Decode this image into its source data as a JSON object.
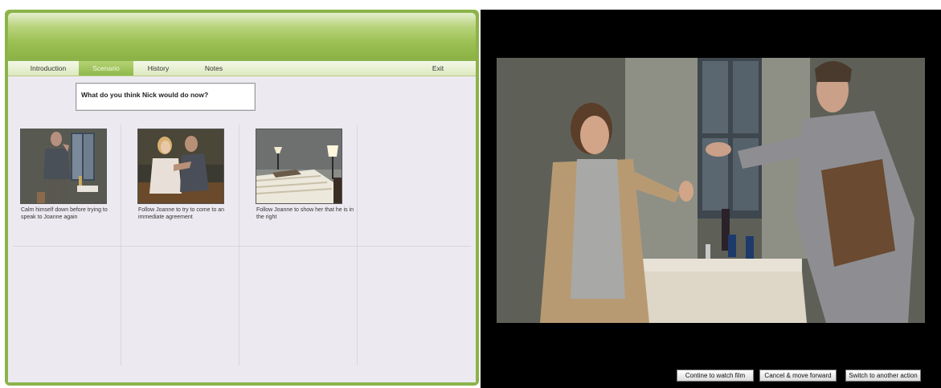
{
  "tabs": [
    {
      "label": "Introduction",
      "active": false
    },
    {
      "label": "Scenario",
      "active": true
    },
    {
      "label": "History",
      "active": false
    },
    {
      "label": "Notes",
      "active": false
    }
  ],
  "exit_label": "Exit",
  "question": "What do you think Nick would do now?",
  "options": [
    {
      "caption": "Calm himself down before trying to speak to Joanne again",
      "thumbnail": "man-at-window-thumbnail"
    },
    {
      "caption": "Follow Joanne to try to come to an immediate agreement",
      "thumbnail": "couple-on-bed-thumbnail"
    },
    {
      "caption": "Follow Joanne to show her that he is in the right",
      "thumbnail": "empty-bedroom-thumbnail"
    }
  ],
  "video": {
    "scene": "argument-in-dining-room-video"
  },
  "video_buttons": {
    "continue": "Contine to watch film",
    "cancel": "Cancel & move forward",
    "switch": "Switch to another action"
  },
  "colors": {
    "accent_green": "#8cb34a",
    "active_tab": "#9cc054",
    "content_bg": "#eceaf0",
    "video_bg": "#000000"
  }
}
